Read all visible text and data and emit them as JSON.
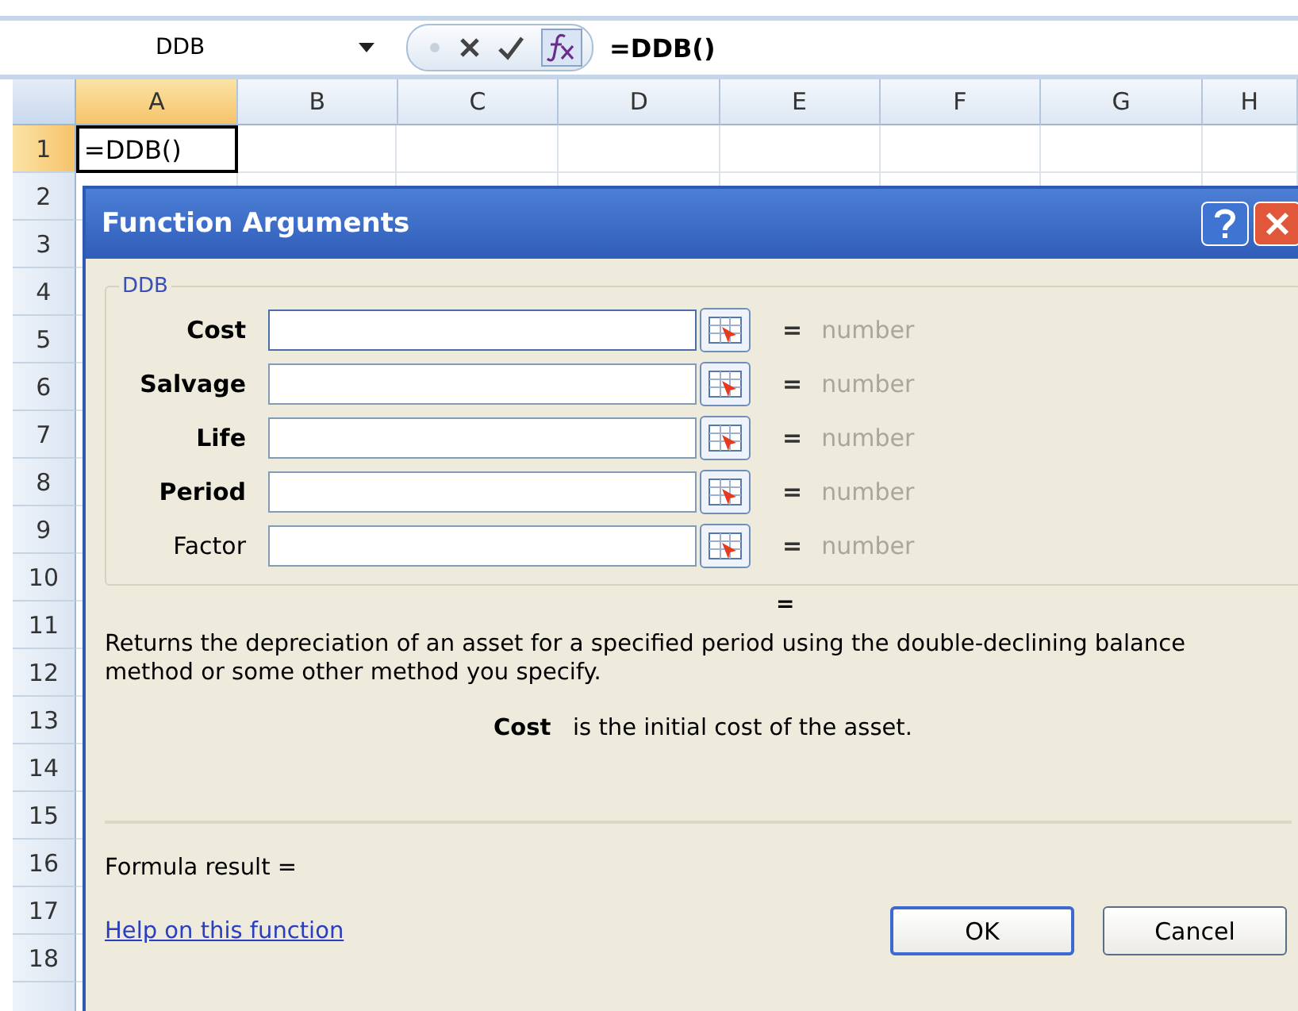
{
  "formula_bar": {
    "name_box": "DDB",
    "formula": "=DDB()"
  },
  "columns": [
    {
      "label": "A",
      "selected": true
    },
    {
      "label": "B",
      "selected": false
    },
    {
      "label": "C",
      "selected": false
    },
    {
      "label": "D",
      "selected": false
    },
    {
      "label": "E",
      "selected": false
    },
    {
      "label": "F",
      "selected": false
    },
    {
      "label": "G",
      "selected": false
    },
    {
      "label": "H",
      "selected": false
    }
  ],
  "rows": [
    {
      "label": "1",
      "selected": true,
      "cells": [
        "=DDB()"
      ]
    },
    {
      "label": "2",
      "selected": false
    },
    {
      "label": "3",
      "selected": false
    },
    {
      "label": "4",
      "selected": false
    },
    {
      "label": "5",
      "selected": false
    },
    {
      "label": "6",
      "selected": false
    },
    {
      "label": "7",
      "selected": false
    },
    {
      "label": "8",
      "selected": false
    },
    {
      "label": "9",
      "selected": false
    },
    {
      "label": "10",
      "selected": false
    },
    {
      "label": "11",
      "selected": false
    },
    {
      "label": "12",
      "selected": false
    },
    {
      "label": "13",
      "selected": false
    },
    {
      "label": "14",
      "selected": false
    },
    {
      "label": "15",
      "selected": false
    },
    {
      "label": "16",
      "selected": false
    },
    {
      "label": "17",
      "selected": false
    },
    {
      "label": "18",
      "selected": false
    }
  ],
  "dialog": {
    "title": "Function Arguments",
    "group": "DDB",
    "arguments": [
      {
        "label": "Cost",
        "required": true,
        "focused": true,
        "equals": "=",
        "result": "number"
      },
      {
        "label": "Salvage",
        "required": true,
        "focused": false,
        "equals": "=",
        "result": "number"
      },
      {
        "label": "Life",
        "required": true,
        "focused": false,
        "equals": "=",
        "result": "number"
      },
      {
        "label": "Period",
        "required": true,
        "focused": false,
        "equals": "=",
        "result": "number"
      },
      {
        "label": "Factor",
        "required": false,
        "focused": false,
        "equals": "=",
        "result": "number"
      }
    ],
    "result_equals": "=",
    "description": "Returns the depreciation of an asset for a specified period using the double-declining balance method or some other method you specify.",
    "argument_help": {
      "name": "Cost",
      "text": "is the initial cost of the asset."
    },
    "formula_result": "Formula result =",
    "help_link": "Help on this function",
    "buttons": [
      {
        "label": "OK",
        "default": true
      },
      {
        "label": "Cancel",
        "default": false
      }
    ]
  }
}
